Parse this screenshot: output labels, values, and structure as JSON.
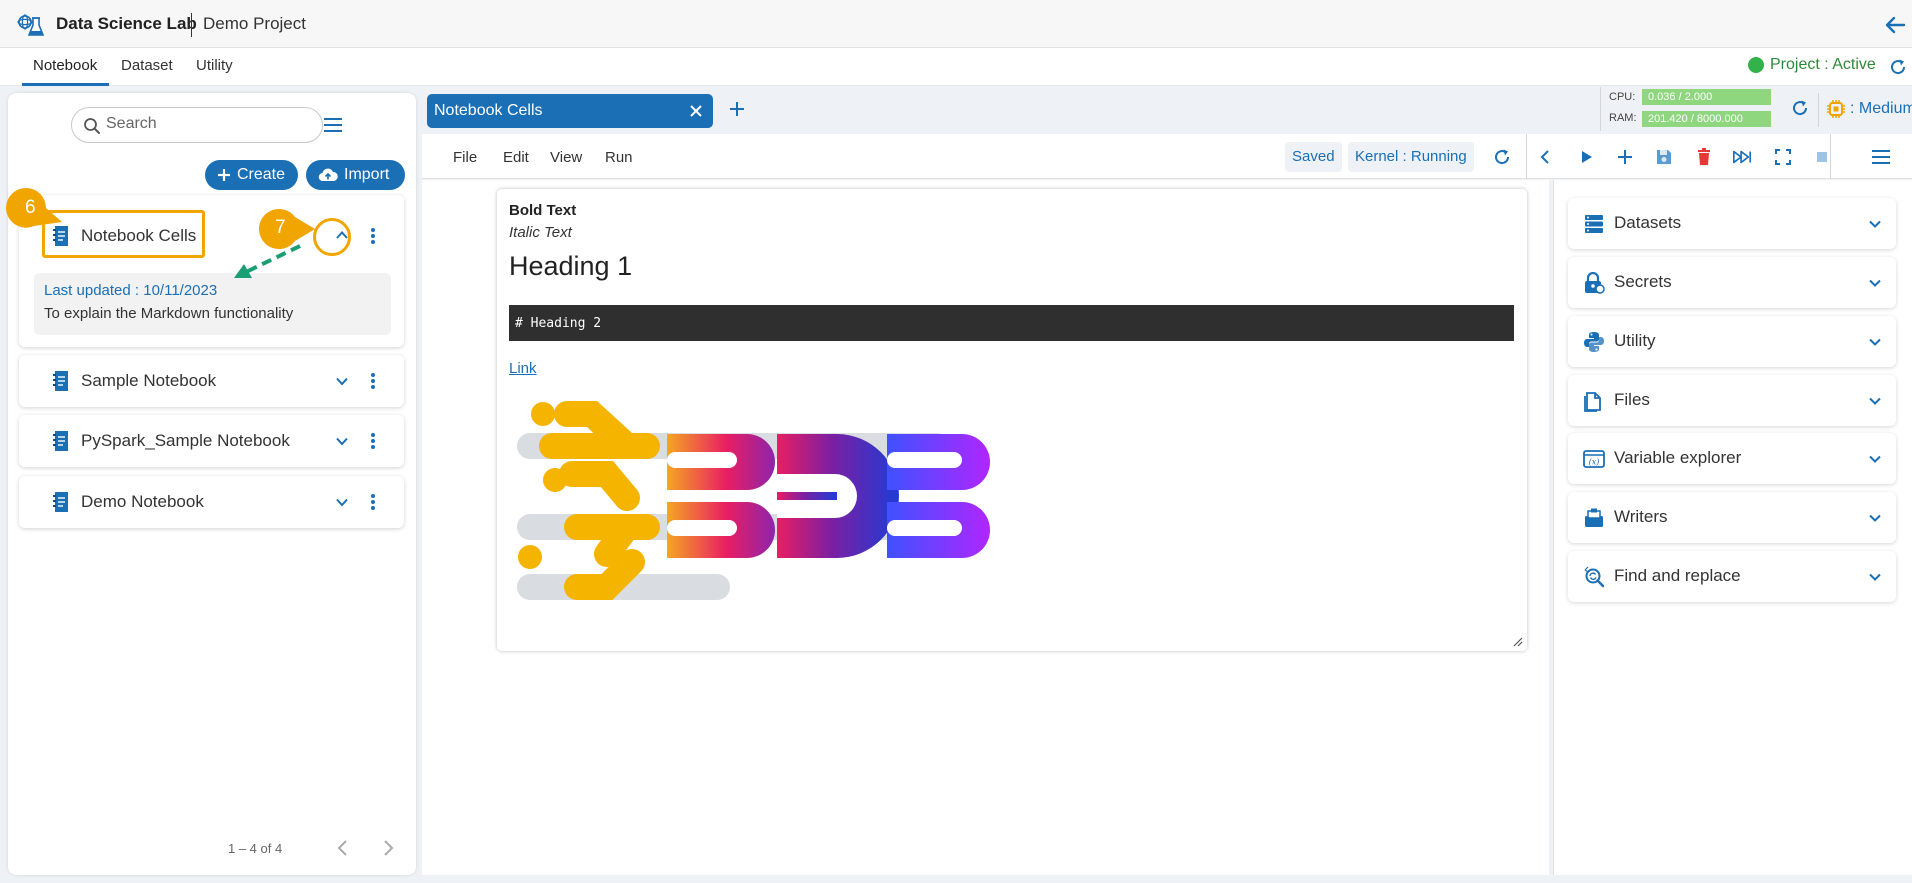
{
  "header": {
    "app_title": "Data Science Lab",
    "project_name": "Demo Project"
  },
  "nav": {
    "tabs": [
      {
        "label": "Notebook",
        "active": true
      },
      {
        "label": "Dataset",
        "active": false
      },
      {
        "label": "Utility",
        "active": false
      }
    ],
    "project_status": "Project : Active"
  },
  "sidebar": {
    "search_placeholder": "Search",
    "create_label": "Create",
    "import_label": "Import",
    "notebooks": [
      {
        "name": "Notebook Cells",
        "expanded": true,
        "last_updated": "Last updated : 10/11/2023",
        "description": "To explain the Markdown functionality"
      },
      {
        "name": "Sample Notebook",
        "expanded": false
      },
      {
        "name": "PySpark_Sample Notebook",
        "expanded": false
      },
      {
        "name": "Demo Notebook",
        "expanded": false
      }
    ],
    "pager_text": "1 – 4 of 4"
  },
  "annotations": {
    "marker_a": "6",
    "marker_b": "7"
  },
  "editor": {
    "active_tab": "Notebook Cells",
    "resources": {
      "cpu_label": "CPU:",
      "cpu_value": "0.036 / 2.000",
      "ram_label": "RAM:",
      "ram_value": "201.420 / 8000.000",
      "size_label": ": Medium"
    },
    "menu": [
      "File",
      "Edit",
      "View",
      "Run"
    ],
    "saved_label": "Saved",
    "kernel_label": "Kernel : Running",
    "cell": {
      "bold_text": "Bold Text",
      "italic_text": "Italic Text",
      "heading1": "Heading 1",
      "code": "# Heading 2",
      "link": "Link"
    }
  },
  "right_panel": {
    "items": [
      {
        "label": "Datasets",
        "icon": "datasets-icon"
      },
      {
        "label": "Secrets",
        "icon": "secrets-icon"
      },
      {
        "label": "Utility",
        "icon": "python-icon"
      },
      {
        "label": "Files",
        "icon": "files-icon"
      },
      {
        "label": "Variable explorer",
        "icon": "variable-explorer-icon"
      },
      {
        "label": "Writers",
        "icon": "writers-icon"
      },
      {
        "label": "Find and replace",
        "icon": "find-replace-icon"
      }
    ]
  },
  "colors": {
    "primary": "#1a6fb5",
    "highlight": "#f0a500",
    "active_status": "#33b24a",
    "resource_bar": "#8fd77f",
    "delete": "#e53935"
  }
}
